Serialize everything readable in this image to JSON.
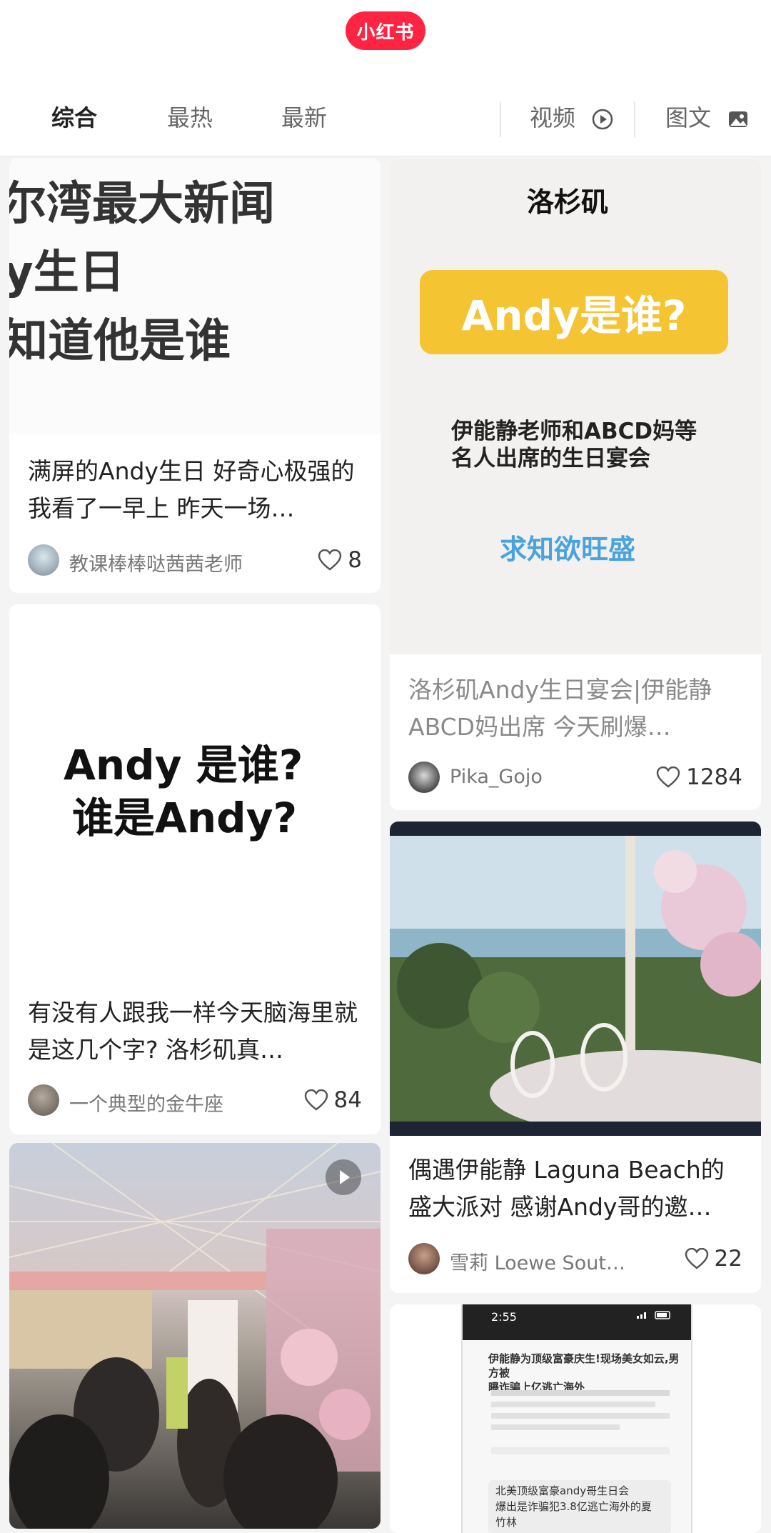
{
  "app": {
    "logo_text": "小红书",
    "brand_color": "#ff2442"
  },
  "tabs": {
    "t1": "综合",
    "t2": "最热",
    "t3": "最新",
    "t4": "视频",
    "t5": "图文"
  },
  "cards": {
    "c1": {
      "cover_lines": [
        "尔湾最大新闻",
        "y生日",
        "知道他是谁"
      ],
      "title": "满屏的Andy生日 好奇心极强的我看了一早上 昨天一场…",
      "author": "教课棒棒哒茜茜老师",
      "likes": "8"
    },
    "c2": {
      "cover_lines": [
        "Andy 是谁?",
        "谁是Andy?"
      ],
      "title": "有没有人跟我一样今天脑海里就是这几个字? 洛杉矶真…",
      "author": "一个典型的金牛座",
      "likes": "84"
    },
    "c3": {
      "cover_kind": "video"
    },
    "c4": {
      "cover_heading": "洛杉矶",
      "cover_badge": "Andy是谁?",
      "cover_sub1": "伊能静老师和ABCD妈等",
      "cover_sub2": "名人出席的生日宴会",
      "cover_blue": "求知欲旺盛",
      "title": "洛杉矶Andy生日宴会|伊能静ABCD妈出席 今天刷爆…",
      "author": "Pika_Gojo",
      "likes": "1284"
    },
    "c5": {
      "title": "偶遇伊能静 Laguna Beach的盛大派对 感谢Andy哥的邀…",
      "author": "雪莉 Loewe South Co...",
      "likes": "22"
    },
    "c6": {
      "phone_time": "2:55",
      "news_title1": "伊能静为顶级富豪庆生!现场美女如云,男方被",
      "news_title2": "曝诈骗上亿逃亡海外",
      "quote1": "北美顶级富豪andy哥生日会",
      "quote2": "爆出是诈骗犯3.8亿逃亡海外的夏",
      "quote3": "竹林"
    }
  }
}
